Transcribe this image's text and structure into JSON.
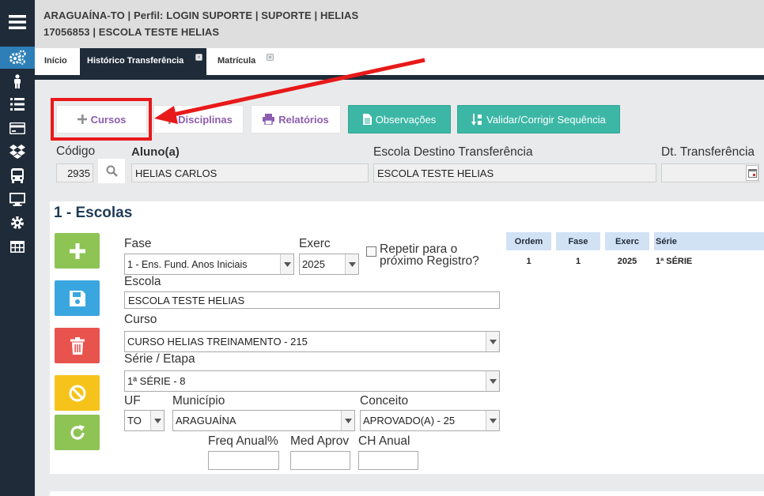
{
  "header": {
    "line1": "ARAGUAÍNA-TO | Perfil: LOGIN SUPORTE | SUPORTE | HELIAS",
    "line2": "17056853 | ESCOLA TESTE HELIAS"
  },
  "tabs": [
    {
      "label": "Início"
    },
    {
      "label": "Histórico Transferência"
    },
    {
      "label": "Matrícula"
    }
  ],
  "toolbar": {
    "cursos": "Cursos",
    "disciplinas": "Disciplinas",
    "relatorios": "Relatórios",
    "observacoes": "Observações",
    "validar": "Validar/Corrigir Sequência"
  },
  "student": {
    "codigo_label": "Código",
    "codigo_value": "2935",
    "aluno_label": "Aluno(a)",
    "aluno_value": "HELIAS CARLOS",
    "escola_destino_label": "Escola Destino Transferência",
    "escola_destino_value": "ESCOLA TESTE HELIAS",
    "dt_label": "Dt. Transferência",
    "dt_value": ""
  },
  "section": {
    "title": "1 - Escolas"
  },
  "form": {
    "fase_label": "Fase",
    "fase_value": "1 - Ens. Fund. Anos Iniciais",
    "exerc_label": "Exerc",
    "exerc_value": "2025",
    "repetir_label_1": "Repetir para o",
    "repetir_label_2": "próximo Registro?",
    "escola_label": "Escola",
    "escola_value": "ESCOLA TESTE HELIAS",
    "curso_label": "Curso",
    "curso_value": "CURSO HELIAS TREINAMENTO - 215",
    "serie_label": "Série / Etapa",
    "serie_value": "1ª SÉRIE - 8",
    "uf_label": "UF",
    "uf_value": "TO",
    "municipio_label": "Município",
    "municipio_value": "ARAGUAÍNA",
    "conceito_label": "Conceito",
    "conceito_value": "APROVADO(A) - 25",
    "freq_label": "Freq Anual%",
    "freq_value": "",
    "med_label": "Med Aprov",
    "med_value": "",
    "ch_label": "CH Anual",
    "ch_value": ""
  },
  "grid": {
    "headers": [
      "Ordem",
      "Fase",
      "Exerc",
      "Série"
    ],
    "rows": [
      [
        "1",
        "1",
        "2025",
        "1ª SÉRIE"
      ]
    ]
  },
  "colors": {
    "sidebar": "#1f2b39",
    "green": "#8dc454",
    "blue": "#3aa6e0",
    "red": "#e8534e",
    "yellow": "#f6c31b",
    "teal": "#3cb7a6",
    "highlight": "#e8191a"
  },
  "icons": {
    "sidebar": [
      "menu-icon",
      "gears-icon",
      "person-icon",
      "list-icon",
      "card-icon",
      "dropbox-icon",
      "bus-icon",
      "monitor-icon",
      "gear-icon",
      "table-icon"
    ]
  }
}
